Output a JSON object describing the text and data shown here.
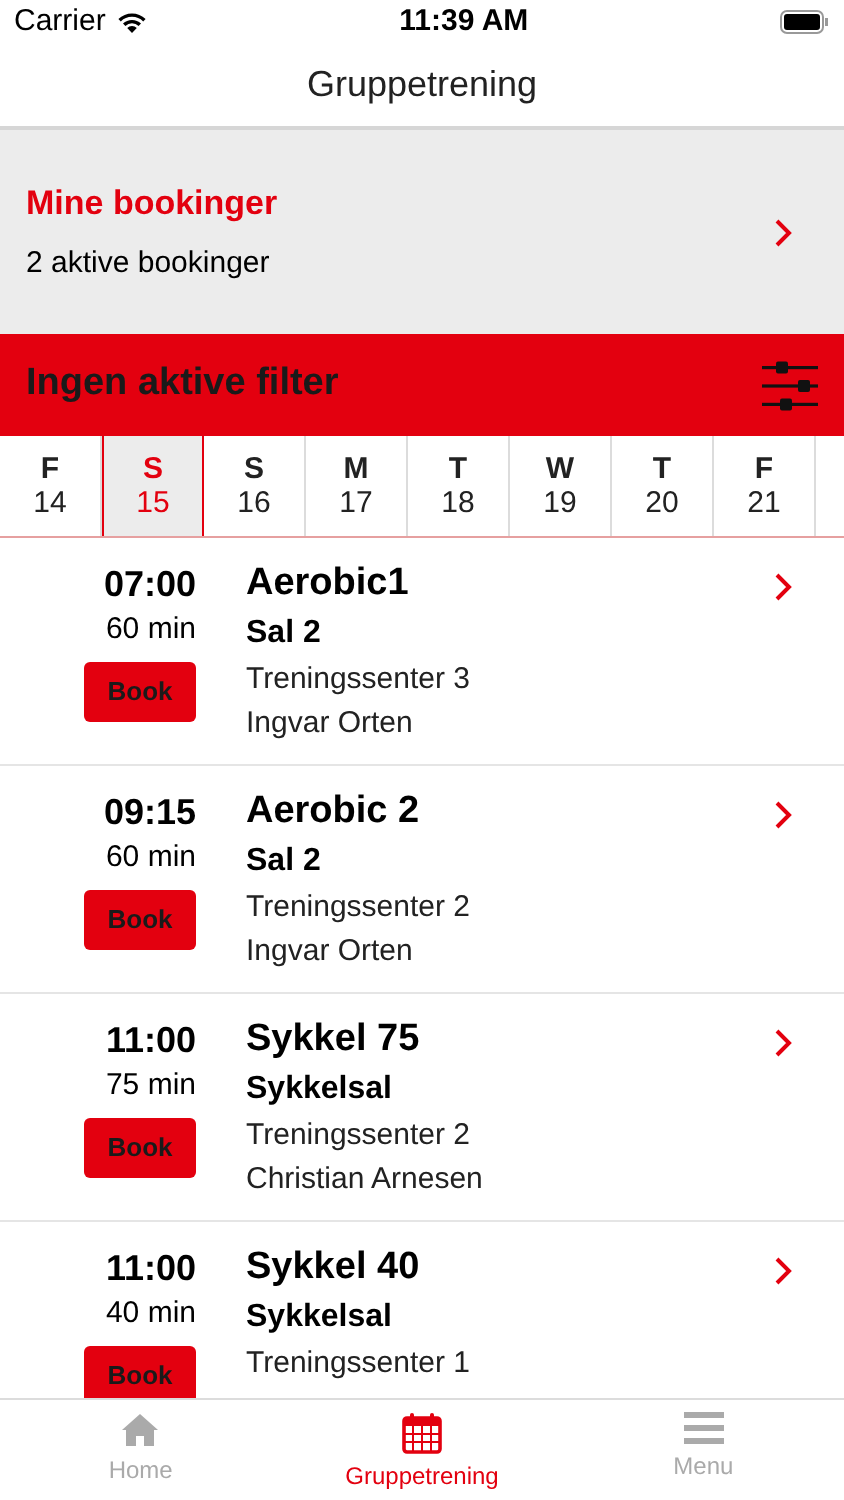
{
  "status_bar": {
    "carrier": "Carrier",
    "time": "11:39 AM"
  },
  "nav": {
    "title": "Gruppetrening"
  },
  "bookings": {
    "title": "Mine bookinger",
    "subtitle": "2 aktive bookinger"
  },
  "filter": {
    "label": "Ingen aktive filter"
  },
  "days": [
    {
      "weekday": "F",
      "date": "14",
      "selected": false
    },
    {
      "weekday": "S",
      "date": "15",
      "selected": true
    },
    {
      "weekday": "S",
      "date": "16",
      "selected": false
    },
    {
      "weekday": "M",
      "date": "17",
      "selected": false
    },
    {
      "weekday": "T",
      "date": "18",
      "selected": false
    },
    {
      "weekday": "W",
      "date": "19",
      "selected": false
    },
    {
      "weekday": "T",
      "date": "20",
      "selected": false
    },
    {
      "weekday": "F",
      "date": "21",
      "selected": false
    }
  ],
  "classes": [
    {
      "time": "07:00",
      "duration": "60 min",
      "button": "Book",
      "name": "Aerobic1",
      "room": "Sal 2",
      "center": "Treningssenter 3",
      "instructor": "Ingvar Orten"
    },
    {
      "time": "09:15",
      "duration": "60 min",
      "button": "Book",
      "name": "Aerobic 2",
      "room": "Sal 2",
      "center": "Treningssenter 2",
      "instructor": "Ingvar Orten"
    },
    {
      "time": "11:00",
      "duration": "75 min",
      "button": "Book",
      "name": "Sykkel 75",
      "room": "Sykkelsal",
      "center": "Treningssenter 2",
      "instructor": "Christian Arnesen"
    },
    {
      "time": "11:00",
      "duration": "40 min",
      "button": "Book",
      "name": "Sykkel 40",
      "room": "Sykkelsal",
      "center": "Treningssenter 1"
    }
  ],
  "tab_bar": [
    {
      "kind": "home",
      "label": "Home",
      "selected": false
    },
    {
      "kind": "calendar",
      "label": "Gruppetrening",
      "selected": true
    },
    {
      "kind": "menu",
      "label": "Menu",
      "selected": false
    }
  ]
}
